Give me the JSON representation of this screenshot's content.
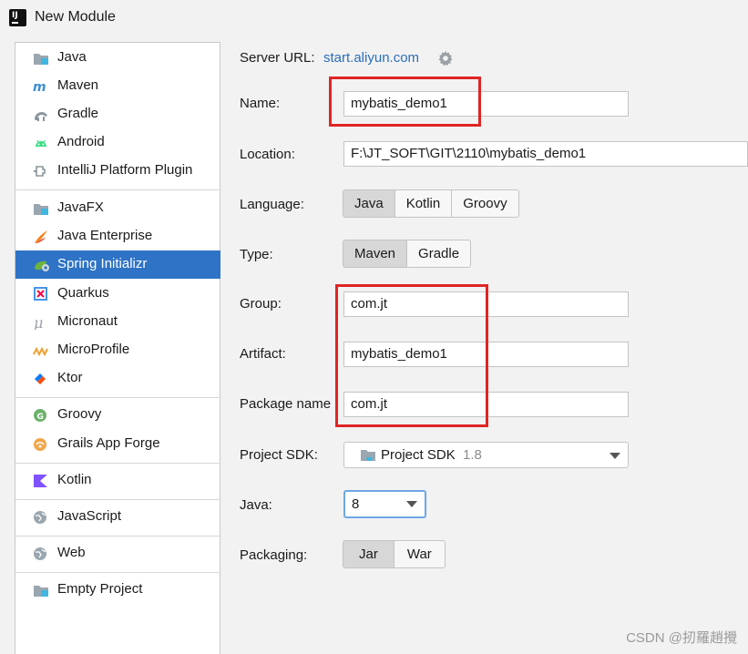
{
  "window": {
    "title": "New Module"
  },
  "sidebar": {
    "items": [
      {
        "label": "Java",
        "icon": "folder-icon"
      },
      {
        "label": "Maven",
        "icon": "maven-icon"
      },
      {
        "label": "Gradle",
        "icon": "gradle-icon"
      },
      {
        "label": "Android",
        "icon": "android-icon"
      },
      {
        "label": "IntelliJ Platform Plugin",
        "icon": "plugin-icon"
      },
      {
        "label": "JavaFX",
        "icon": "folder-icon"
      },
      {
        "label": "Java Enterprise",
        "icon": "java-enterprise-icon"
      },
      {
        "label": "Spring Initializr",
        "icon": "spring-icon",
        "selected": true
      },
      {
        "label": "Quarkus",
        "icon": "quarkus-icon"
      },
      {
        "label": "Micronaut",
        "icon": "micronaut-icon"
      },
      {
        "label": "MicroProfile",
        "icon": "microprofile-icon"
      },
      {
        "label": "Ktor",
        "icon": "ktor-icon"
      },
      {
        "label": "Groovy",
        "icon": "groovy-icon"
      },
      {
        "label": "Grails App Forge",
        "icon": "grails-icon"
      },
      {
        "label": "Kotlin",
        "icon": "kotlin-icon"
      },
      {
        "label": "JavaScript",
        "icon": "globe-icon"
      },
      {
        "label": "Web",
        "icon": "globe-icon"
      },
      {
        "label": "Empty Project",
        "icon": "folder-icon"
      }
    ]
  },
  "form": {
    "server_url_label": "Server URL:",
    "server_url": "start.aliyun.com",
    "name_label": "Name:",
    "name_value": "mybatis_demo1",
    "location_label": "Location:",
    "location_value": "F:\\JT_SOFT\\GIT\\2110\\mybatis_demo1",
    "language_label": "Language:",
    "language_options": [
      "Java",
      "Kotlin",
      "Groovy"
    ],
    "language_selected": "Java",
    "type_label": "Type:",
    "type_options": [
      "Maven",
      "Gradle"
    ],
    "type_selected": "Maven",
    "group_label": "Group:",
    "group_value": "com.jt",
    "artifact_label": "Artifact:",
    "artifact_value": "mybatis_demo1",
    "package_label": "Package name",
    "package_value": "com.jt",
    "sdk_label": "Project SDK:",
    "sdk_value": "Project SDK",
    "sdk_version": "1.8",
    "java_label": "Java:",
    "java_value": "8",
    "packaging_label": "Packaging:",
    "packaging_options": [
      "Jar",
      "War"
    ],
    "packaging_selected": "Jar"
  },
  "watermark": "CSDN @扨羅趙攪",
  "colors": {
    "selection": "#2e73c5",
    "link": "#2a6ebb",
    "highlight": "#e02424"
  }
}
